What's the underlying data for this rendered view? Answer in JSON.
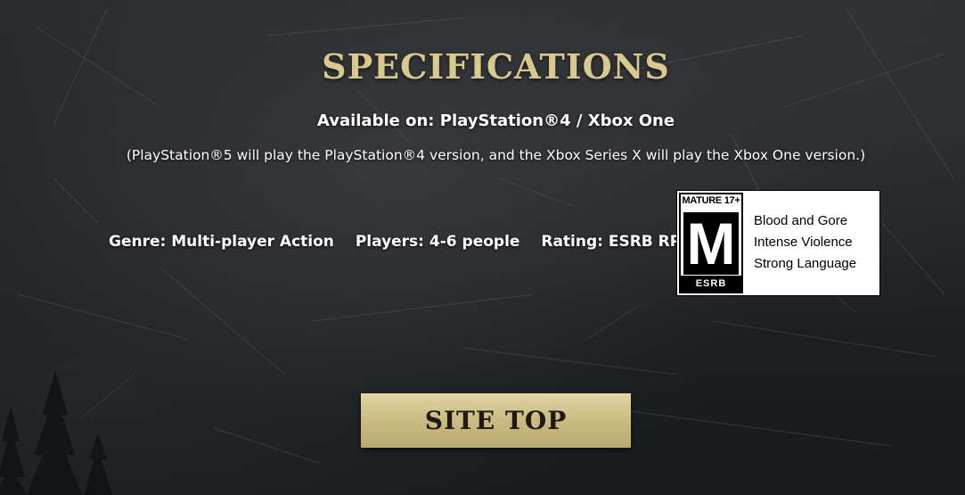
{
  "section": {
    "title": "SPECIFICATIONS",
    "available": "Available on: PlayStation®4 / Xbox One",
    "note": "(PlayStation®5 will play the PlayStation®4 version, and the Xbox Series X will play the Xbox One version.)"
  },
  "specs": {
    "genre": "Genre: Multi-player Action",
    "players": "Players: 4-6 people",
    "rating": "Rating: ESRB RP"
  },
  "esrb": {
    "badge_top": "MATURE 17+",
    "badge_letter": "M",
    "badge_bottom": "ESRB",
    "descriptors": [
      "Blood and Gore",
      "Intense Violence",
      "Strong Language"
    ]
  },
  "nav": {
    "site_top_label": "SITE TOP"
  },
  "colors": {
    "title": "#d9c98e",
    "button": "#cdbd85",
    "background": "#1f2124"
  }
}
